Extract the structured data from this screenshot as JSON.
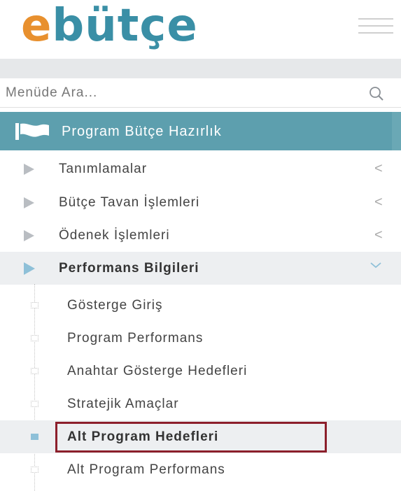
{
  "header": {
    "logo_e": "e",
    "logo_rest": "bütçe",
    "brand_orange": "#e8902e",
    "brand_blue": "#3a8fa6"
  },
  "search": {
    "placeholder": "Menüde Ara...",
    "icon": "search-icon"
  },
  "section": {
    "label": "Program Bütçe Hazırlık",
    "icon": "flag-icon",
    "color": "#5d9fae"
  },
  "menu": {
    "items": [
      {
        "label": "Tanımlamalar",
        "indicator": "<"
      },
      {
        "label": "Bütçe Tavan İşlemleri",
        "indicator": "<"
      },
      {
        "label": "Ödenek İşlemleri",
        "indicator": "<"
      },
      {
        "label": "Performans Bilgileri",
        "expanded": true
      }
    ]
  },
  "submenu": {
    "items": [
      {
        "label": "Gösterge Giriş"
      },
      {
        "label": "Program Performans"
      },
      {
        "label": "Anahtar Gösterge Hedefleri"
      },
      {
        "label": "Stratejik Amaçlar"
      },
      {
        "label": "Alt Program Hedefleri",
        "selected": true
      },
      {
        "label": "Alt Program Performans"
      }
    ],
    "highlight_color": "#8c1f2b"
  }
}
